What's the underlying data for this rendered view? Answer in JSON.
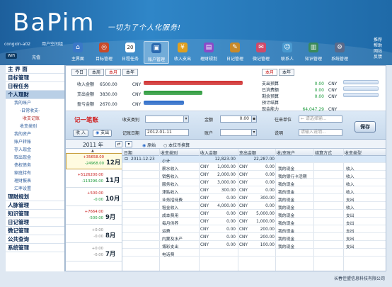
{
  "app": {
    "logo": "BaPim",
    "slogan": "一切为了个人化服务!",
    "user_line": [
      "congxin-a02",
      "用户空间组"
    ],
    "wifi": "WiFi",
    "charge": "充值"
  },
  "nav": [
    {
      "label": "主界面",
      "icon": "home-icon",
      "color": "#3a78c8"
    },
    {
      "label": "目标管理",
      "icon": "target-icon",
      "color": "#c84a2a"
    },
    {
      "label": "日程任务",
      "icon": "calendar-icon",
      "color": "#3aa84a",
      "date": "20"
    },
    {
      "label": "账户管理",
      "icon": "wallet-icon",
      "color": "#2a6ab0",
      "active": true
    },
    {
      "label": "收入支出",
      "icon": "money-icon",
      "color": "#e0a020"
    },
    {
      "label": "理财规划",
      "icon": "chart-icon",
      "color": "#8a4ac8"
    },
    {
      "label": "日记管理",
      "icon": "diary-icon",
      "color": "#c88a2a"
    },
    {
      "label": "微记管理",
      "icon": "note-icon",
      "color": "#d04a6a"
    },
    {
      "label": "联系人",
      "icon": "contacts-icon",
      "color": "#4a9ad0"
    },
    {
      "label": "知识管理",
      "icon": "book-icon",
      "color": "#3a8a5a"
    },
    {
      "label": "系统管理",
      "icon": "settings-icon",
      "color": "#5a6a8a"
    }
  ],
  "right_links": [
    "推荐",
    "帮助",
    "网站",
    "反馈"
  ],
  "sidebar": [
    {
      "label": "主 界 面",
      "type": "cat"
    },
    {
      "label": "目标管理",
      "type": "cat"
    },
    {
      "label": "日程任务",
      "type": "cat"
    },
    {
      "label": "个人理财",
      "type": "cat",
      "selected": true
    },
    {
      "label": "我的账户",
      "type": "sub"
    },
    {
      "label": "-日常收支-",
      "type": "sub2"
    },
    {
      "label": "收支记账",
      "type": "sub3"
    },
    {
      "label": "收支类别",
      "type": "sub3b"
    },
    {
      "label": "我的资产",
      "type": "sub"
    },
    {
      "label": "账户转账",
      "type": "sub"
    },
    {
      "label": "存入现金",
      "type": "sub"
    },
    {
      "label": "取出现金",
      "type": "sub"
    },
    {
      "label": "债权债务",
      "type": "sub"
    },
    {
      "label": "家庭持有",
      "type": "sub"
    },
    {
      "label": "理财报表",
      "type": "sub"
    },
    {
      "label": "汇率设置",
      "type": "sub"
    },
    {
      "label": "理财规划",
      "type": "cat"
    },
    {
      "label": "人脉管理",
      "type": "cat"
    },
    {
      "label": "知识管理",
      "type": "cat"
    },
    {
      "label": "日记管理",
      "type": "cat"
    },
    {
      "label": "微记管理",
      "type": "cat"
    },
    {
      "label": "公共查询",
      "type": "cat"
    },
    {
      "label": "系统管理",
      "type": "cat"
    }
  ],
  "period_tabs": [
    "今日",
    "本周",
    "本月",
    "本年"
  ],
  "period_active": "本月",
  "right_tabs": [
    "本月",
    "本年"
  ],
  "right_active": "本月",
  "summary": {
    "income": {
      "label": "收入金额",
      "value": "6500.00",
      "unit": "CNY",
      "ratio": 1.0,
      "color": "#d03030"
    },
    "expense": {
      "label": "支出金额",
      "value": "3830.00",
      "unit": "CNY",
      "ratio": 0.59,
      "color": "#2a9a3a"
    },
    "surplus": {
      "label": "盈亏金额",
      "value": "2670.00",
      "unit": "CNY",
      "ratio": 0.41,
      "color": "#2a6ac8"
    }
  },
  "right_summary": [
    {
      "label": "支出预算",
      "value": "0.00",
      "unit": "CNY",
      "green": true
    },
    {
      "label": "已消费额",
      "value": "0.00",
      "unit": "CNY",
      "green": true
    },
    {
      "label": "剩余预算",
      "value": "0.00",
      "unit": "CNY",
      "green": true
    },
    {
      "label": "预计结算",
      "value": "",
      "unit": "",
      "green": false
    },
    {
      "label": "现金能力",
      "value": "64,047.29",
      "unit": "CNY",
      "green": true
    }
  ],
  "entry": {
    "title": "记一笔账",
    "income_btn": "收 入",
    "expense_btn": "支出",
    "category_label": "收支类别",
    "category_value": "",
    "amount_label": "金额",
    "amount_value": "0.00",
    "date_label": "记账日期",
    "date_value": "2012-01-11",
    "account_label": "账户",
    "account_value": "",
    "from_label": "往来单位",
    "from_placeholder": "← 请选择输...",
    "note_label": "说明",
    "note_placeholder": "请输入说明...",
    "save": "保存"
  },
  "year_bar": {
    "year": "2011 年",
    "radio1": "原始",
    "radio2": "本位币换算"
  },
  "months": [
    {
      "month": "12月",
      "plus": "+35658.00",
      "minus": "-24968.00",
      "selected": true
    },
    {
      "month": "11月",
      "plus": "+5126200.00",
      "minus": "-113296.00",
      "selected": false
    },
    {
      "month": "10月",
      "plus": "+500.00",
      "minus": "-0.00",
      "selected": false
    },
    {
      "month": "9月",
      "plus": "+7664.00",
      "minus": "-500.00",
      "selected": false
    },
    {
      "month": "8月",
      "plus": "+0.00",
      "minus": "-0.00",
      "selected": false
    },
    {
      "month": "7月",
      "plus": "+0.00",
      "minus": "-0.00",
      "selected": false
    }
  ],
  "table": {
    "columns": [
      "日期",
      "收支类别",
      "收入金额",
      "支出金额",
      "收/支账户",
      "结算方式",
      "收支类型"
    ],
    "rows": [
      {
        "date": "2011-12-23",
        "cat": "小计",
        "in_cur": "",
        "in": "12,823.00",
        "out_cur": "",
        "out": "22,287.00",
        "acct": "",
        "settle": "",
        "type": ""
      },
      {
        "date": "",
        "cat": "薪水收入",
        "in_cur": "CNY",
        "in": "1,000.00",
        "out_cur": "CNY",
        "out": "0.00",
        "acct": "我的现金",
        "settle": "",
        "type": "收入"
      },
      {
        "date": "",
        "cat": "销售收入",
        "in_cur": "CNY",
        "in": "2,000.00",
        "out_cur": "CNY",
        "out": "0.00",
        "acct": "我的银行卡活期",
        "settle": "",
        "type": "收入"
      },
      {
        "date": "",
        "cat": "服务收入",
        "in_cur": "CNY",
        "in": "3,000.00",
        "out_cur": "CNY",
        "out": "0.00",
        "acct": "我的现金",
        "settle": "",
        "type": "收入"
      },
      {
        "date": "",
        "cat": "津贴收入",
        "in_cur": "CNY",
        "in": "300.00",
        "out_cur": "CNY",
        "out": "0.00",
        "acct": "我的现金",
        "settle": "",
        "type": "收入"
      },
      {
        "date": "",
        "cat": "业务招待费",
        "in_cur": "CNY",
        "in": "0.00",
        "out_cur": "CNY",
        "out": "300.00",
        "acct": "我的现金",
        "settle": "",
        "type": "支出"
      },
      {
        "date": "",
        "cat": "租金收入",
        "in_cur": "CNY",
        "in": "4,000.00",
        "out_cur": "CNY",
        "out": "0.00",
        "acct": "我的现金",
        "settle": "",
        "type": "收入"
      },
      {
        "date": "",
        "cat": "成本费用",
        "in_cur": "CNY",
        "in": "0.00",
        "out_cur": "CNY",
        "out": "5,000.00",
        "acct": "我的现金",
        "settle": "",
        "type": "支出"
      },
      {
        "date": "",
        "cat": "每月供养",
        "in_cur": "CNY",
        "in": "0.00",
        "out_cur": "CNY",
        "out": "1,000.00",
        "acct": "我的现金",
        "settle": "",
        "type": "支出"
      },
      {
        "date": "",
        "cat": "运费",
        "in_cur": "CNY",
        "in": "0.00",
        "out_cur": "CNY",
        "out": "200.00",
        "acct": "我的现金",
        "settle": "",
        "type": "支出"
      },
      {
        "date": "",
        "cat": "内蒙及水产",
        "in_cur": "CNY",
        "in": "0.00",
        "out_cur": "CNY",
        "out": "200.00",
        "acct": "我的现金",
        "settle": "",
        "type": "支出"
      },
      {
        "date": "",
        "cat": "博彩支出",
        "in_cur": "CNY",
        "in": "0.00",
        "out_cur": "CNY",
        "out": "100.00",
        "acct": "我的现金",
        "settle": "",
        "type": "支出"
      },
      {
        "date": "",
        "cat": "电话费",
        "in_cur": "",
        "in": "",
        "out_cur": "",
        "out": "",
        "acct": "",
        "settle": "",
        "type": ""
      }
    ]
  },
  "footer": "长春佳盟信息科技有限公司"
}
